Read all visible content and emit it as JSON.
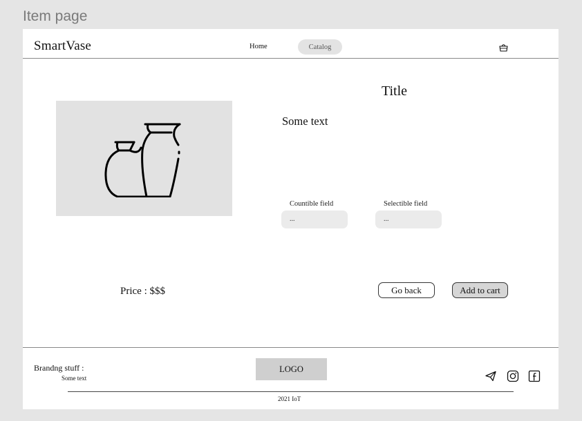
{
  "frame": {
    "label": "Item page"
  },
  "header": {
    "brand": "SmartVase",
    "nav": [
      {
        "label": "Home"
      },
      {
        "label": "Catalog"
      }
    ],
    "cart_icon": "basket-icon"
  },
  "product": {
    "image_icon": "vases-illustration",
    "title": "Title",
    "description": "Some text",
    "countible_field": {
      "label": "Countible field",
      "placeholder": "..."
    },
    "selectible_field": {
      "label": "Selectible field",
      "placeholder": "..."
    },
    "price": "Price : $$$",
    "go_back_label": "Go back",
    "add_to_cart_label": "Add to cart"
  },
  "footer": {
    "branding_title": "Brandng stuff :",
    "branding_text": "Some text",
    "logo": "LOGO",
    "social_icons": [
      "telegram-icon",
      "instagram-icon",
      "facebook-icon"
    ],
    "copyright": "2021 IoT"
  },
  "colors": {
    "page_bg": "#e5e5e5",
    "frame_bg": "#ffffff",
    "placeholder_grey": "#e2e2e2",
    "add_to_cart_bg": "#d6d6d6"
  }
}
